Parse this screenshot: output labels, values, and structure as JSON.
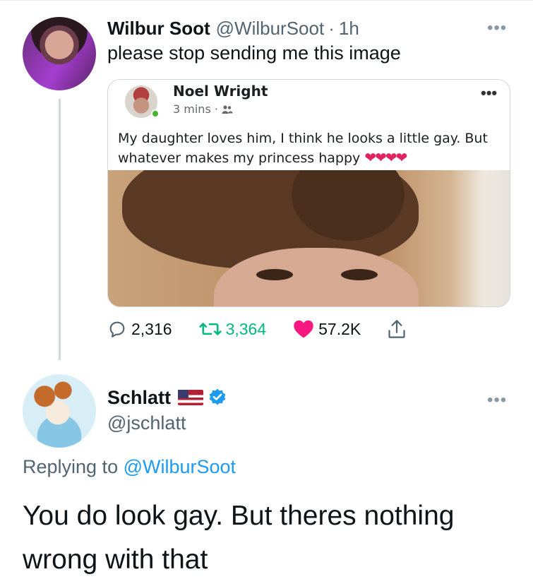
{
  "tweet": {
    "display_name": "Wilbur Soot",
    "handle": "@WilburSoot",
    "separator": "·",
    "time": "1h",
    "text": "please stop sending me this image",
    "more_label": "•••"
  },
  "embedded_post": {
    "author": "Noel Wright",
    "meta": "3 mins ·",
    "audience_icon": "friends-icon",
    "text": "My daughter loves him, I think he looks a little gay. But whatever makes my princess happy",
    "hearts": "❤❤❤❤",
    "more_label": "•••"
  },
  "actions": {
    "replies": "2,316",
    "retweets": "3,364",
    "likes": "57.2K",
    "colors": {
      "retweet": "#00ba7c",
      "like": "#f91880",
      "muted": "#536471"
    }
  },
  "reply": {
    "display_name": "Schlatt",
    "flag_icon": "us-flag-icon",
    "verified_icon": "verified-badge-icon",
    "handle": "@jschlatt",
    "replying_prefix": "Replying to ",
    "replying_to": "@WilburSoot",
    "text": "You do look gay. But theres nothing wrong with that",
    "more_label": "•••"
  }
}
